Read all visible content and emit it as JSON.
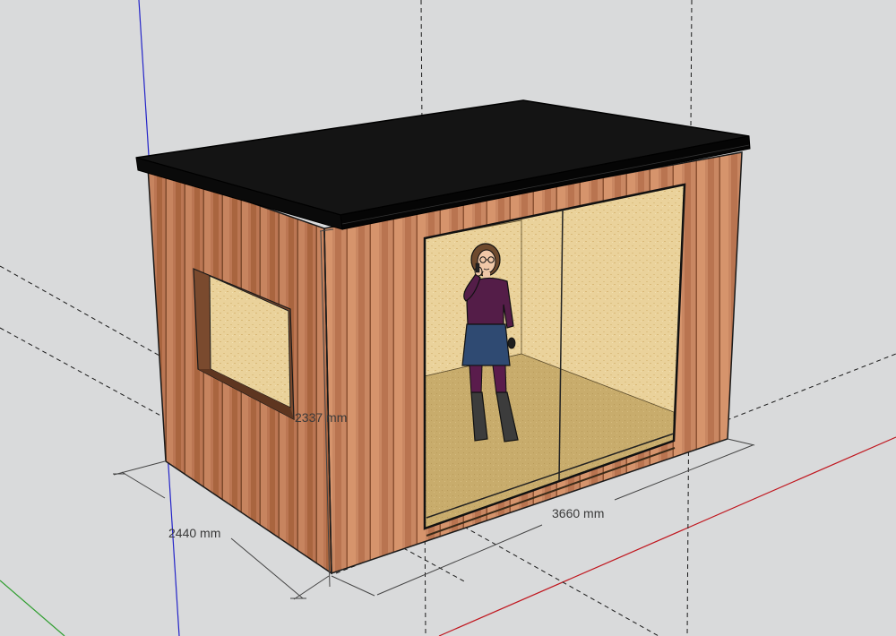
{
  "dimensions": {
    "depth": "2440 mm",
    "height": "2337 mm",
    "width": "3660 mm"
  },
  "colors": {
    "background": "#d9dadb",
    "cladding": "#c98762",
    "cladding_dark": "#a4623f",
    "osb_interior": "#ead29b",
    "floor": "#c8ac6c",
    "roof": "#111111",
    "axis_red": "#c0161e",
    "axis_green": "#2f9e2f",
    "axis_blue": "#2424c8",
    "guide_line": "#1a1a1a",
    "dimension_line": "#444444"
  },
  "scene_elements": {
    "model": "garden-room",
    "person": "scale-figure",
    "opening": "sliding-glass-door",
    "side_window": "window"
  }
}
